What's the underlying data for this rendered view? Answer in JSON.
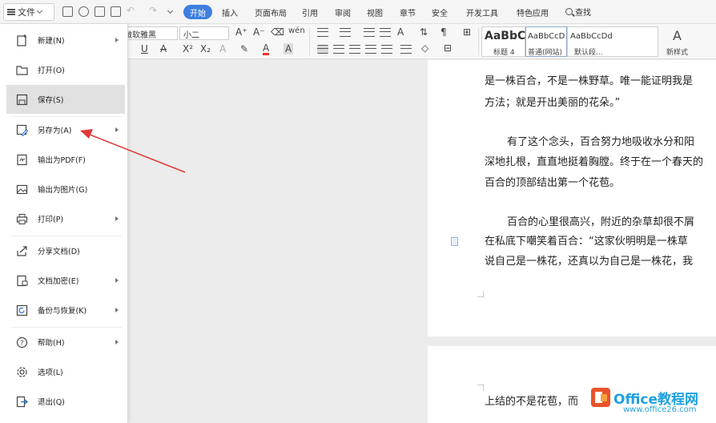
{
  "menubar": {
    "file_label": "文件",
    "tabs": [
      "开始",
      "插入",
      "页面布局",
      "引用",
      "审阅",
      "视图",
      "章节",
      "安全",
      "开发工具",
      "特色应用"
    ],
    "search_label": "查找"
  },
  "ribbon": {
    "font_name": "微软雅黑",
    "font_size": "小二",
    "styles": [
      {
        "sample": "AaBbC",
        "name": "标题 4"
      },
      {
        "sample": "AaBbCcD",
        "name": "普通(网站)"
      },
      {
        "sample": "AaBbCcDd",
        "name": "默认段..."
      }
    ],
    "new_style_label": "新样式"
  },
  "file_menu": {
    "items": [
      {
        "label": "新建(N)",
        "icon": "new-doc-icon",
        "submenu": true
      },
      {
        "label": "打开(O)",
        "icon": "folder-icon",
        "submenu": false
      },
      {
        "label": "保存(S)",
        "icon": "save-icon",
        "submenu": false
      },
      {
        "label": "另存为(A)",
        "icon": "save-as-icon",
        "submenu": true
      },
      {
        "label": "输出为PDF(F)",
        "icon": "pdf-icon",
        "submenu": false
      },
      {
        "label": "输出为图片(G)",
        "icon": "image-icon",
        "submenu": false
      },
      {
        "label": "打印(P)",
        "icon": "print-icon",
        "submenu": true
      },
      {
        "label": "分享文档(D)",
        "icon": "share-icon",
        "submenu": false
      },
      {
        "label": "文档加密(E)",
        "icon": "encrypt-icon",
        "submenu": true
      },
      {
        "label": "备份与恢复(K)",
        "icon": "backup-icon",
        "submenu": true
      },
      {
        "label": "帮助(H)",
        "icon": "help-icon",
        "submenu": true
      },
      {
        "label": "选项(L)",
        "icon": "settings-icon",
        "submenu": false
      },
      {
        "label": "退出(Q)",
        "icon": "exit-icon",
        "submenu": false
      }
    ],
    "highlighted": "保存(S)",
    "pointer_color": "#e03a3a"
  },
  "document": {
    "lines": [
      "是一株百合，不是一株野草。唯一能证明我是",
      "方法；就是开出美丽的花朵。”",
      "有了这个念头，百合努力地吸收水分和阳",
      "深地扎根，直直地挺着胸膛。终于在一个春天的",
      "百合的顶部结出第一个花苞。",
      "百合的心里很高兴，附近的杂草却很不屑",
      "在私底下嘲笑着百合：“这家伙明明是一株草",
      "说自己是一株花，还真以为自己是一株花，我",
      "上结的不是花苞，而"
    ]
  },
  "watermark": {
    "brand": "Office教程网",
    "url": "www.office26.com"
  }
}
